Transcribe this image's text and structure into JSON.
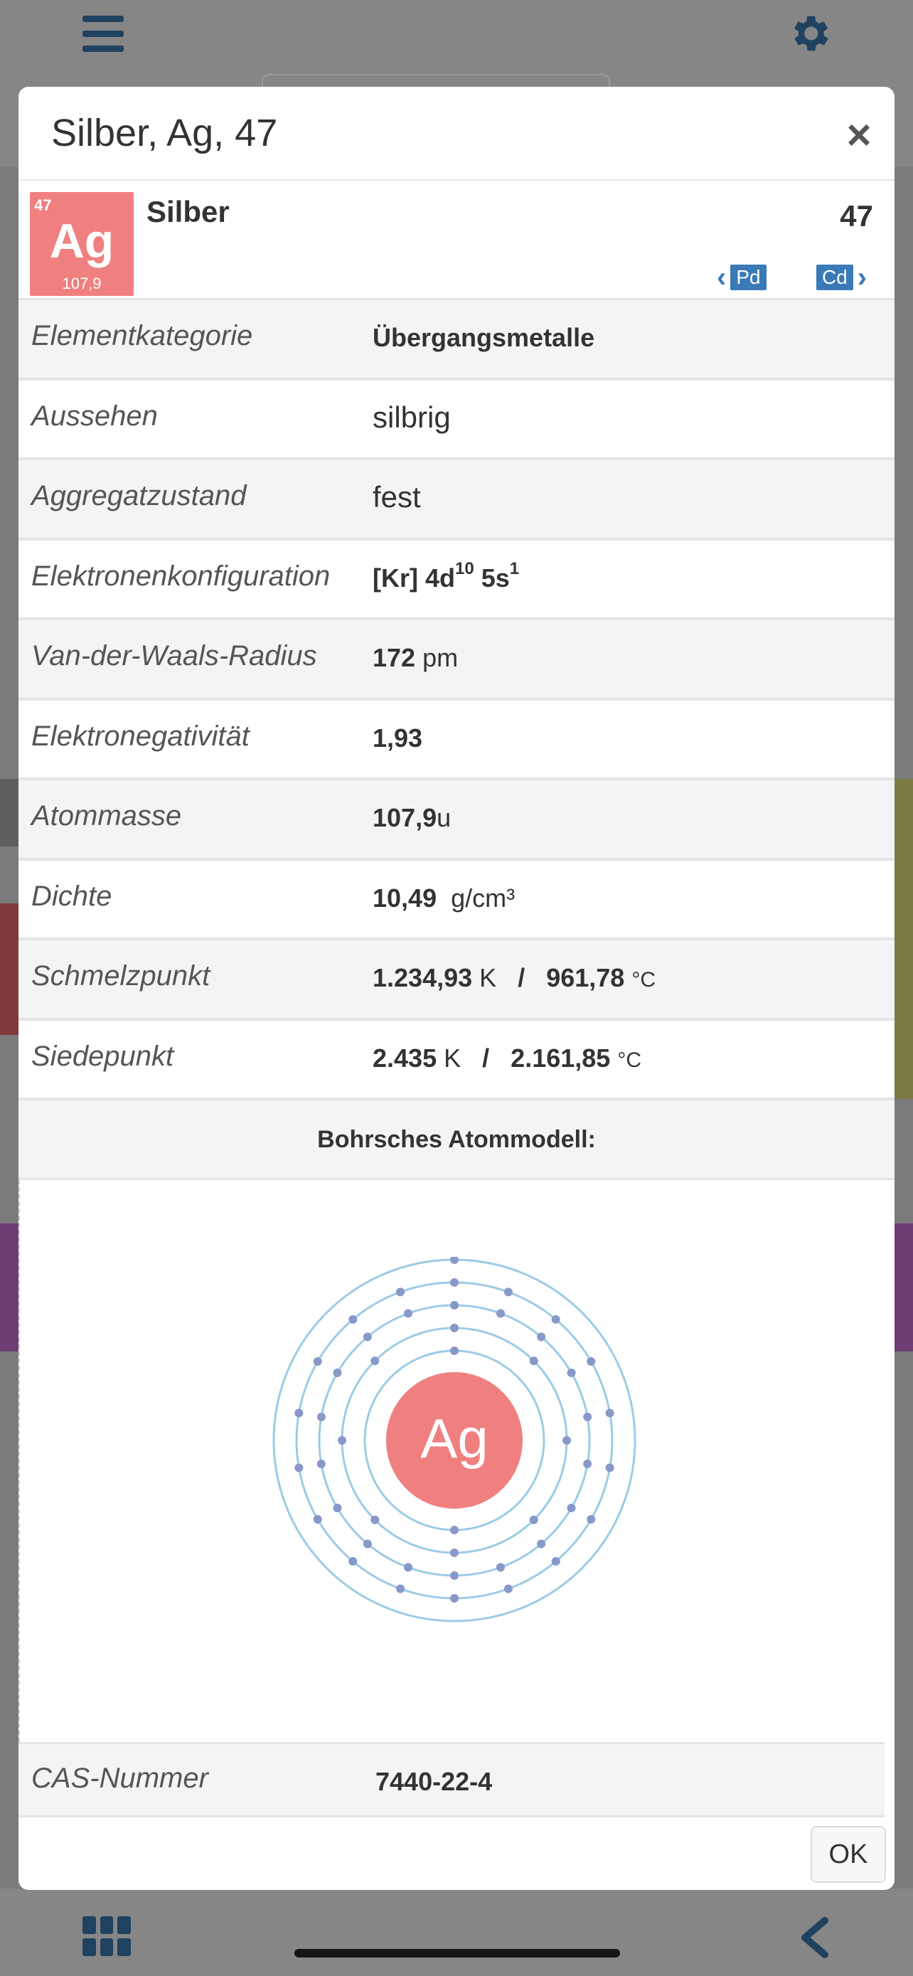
{
  "modal": {
    "title": "Silber, Ag, 47",
    "close_label": "×",
    "ok_label": "OK"
  },
  "element": {
    "number": "47",
    "symbol": "Ag",
    "mass_short": "107,9",
    "name": "Silber",
    "prev_symbol": "Pd",
    "next_symbol": "Cd",
    "tile_color": "#f08080"
  },
  "properties": {
    "category": {
      "label": "Elementkategorie",
      "value": "Übergangsmetalle"
    },
    "appearance": {
      "label": "Aussehen",
      "value": "silbrig"
    },
    "state": {
      "label": "Aggregatzustand",
      "value": "fest"
    },
    "config": {
      "label": "Elektronenkonfiguration",
      "core": "[Kr] 4d",
      "sup1": "10",
      "mid": " 5s",
      "sup2": "1"
    },
    "vdw": {
      "label": "Van-der-Waals-Radius",
      "value": "172",
      "unit": "pm"
    },
    "electroneg": {
      "label": "Elektronegativität",
      "value": "1,93"
    },
    "mass": {
      "label": "Atommasse",
      "value": "107,9",
      "unit": "u"
    },
    "density": {
      "label": "Dichte",
      "value": "10,49",
      "unit": "g/cm³"
    },
    "melting": {
      "label": "Schmelzpunkt",
      "kelvin": "1.234,93",
      "k_unit": "K",
      "sep": "/",
      "celsius": "961,78",
      "c_unit": "°C"
    },
    "boiling": {
      "label": "Siedepunkt",
      "kelvin": "2.435",
      "k_unit": "K",
      "sep": "/",
      "celsius": "2.161,85",
      "c_unit": "°C"
    }
  },
  "bohr": {
    "heading": "Bohrsches Atommodell:",
    "nucleus_label": "Ag",
    "shells": [
      2,
      8,
      18,
      18,
      1
    ]
  },
  "cas": {
    "label": "CAS-Nummer",
    "value": "7440-22-4"
  },
  "colors": {
    "accent": "#3a7ab7",
    "orbit": "#9ccbe6",
    "electron": "#8798c9"
  }
}
